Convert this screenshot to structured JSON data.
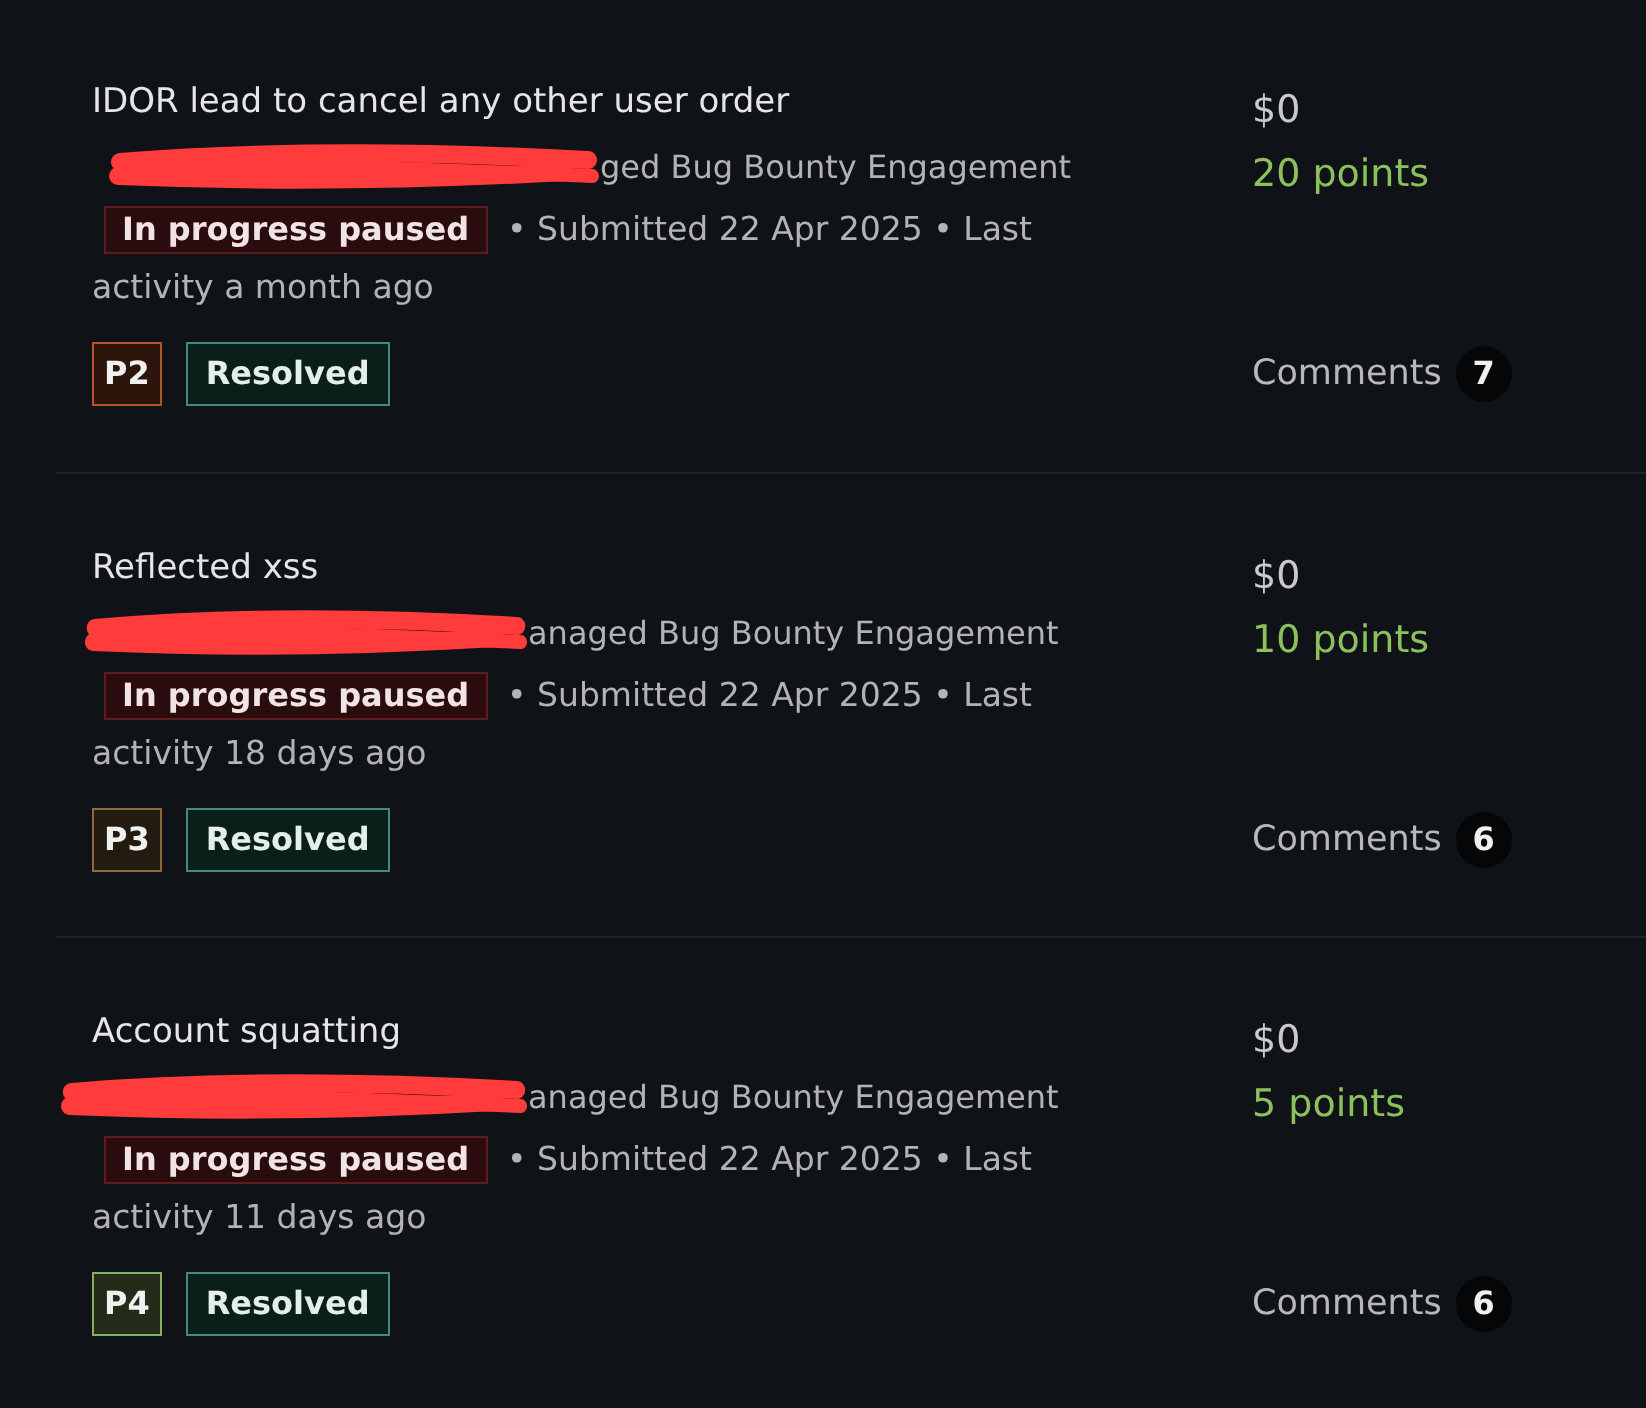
{
  "reports": [
    {
      "title": "IDOR lead to cancel any other user order",
      "program": "ged Bug Bounty Engagement",
      "status": "In progress paused",
      "meta_lines": [
        "• Submitted 22 Apr 2025 • Last",
        "activity a month ago"
      ],
      "severity": {
        "label": "P2",
        "color": "#b5542a"
      },
      "state": "Resolved",
      "bounty": "$0",
      "points": "20 points",
      "comments_label": "Comments",
      "comments_count": "7"
    },
    {
      "title": "Reflected xss",
      "program": "anaged Bug Bounty Engagement",
      "status": "In progress paused",
      "meta_lines": [
        "• Submitted 22 Apr 2025 • Last",
        "activity 18 days ago"
      ],
      "severity": {
        "label": "P3",
        "color": "#8c6a3c"
      },
      "state": "Resolved",
      "bounty": "$0",
      "points": "10 points",
      "comments_label": "Comments",
      "comments_count": "6"
    },
    {
      "title": "Account squatting",
      "program": "anaged Bug Bounty Engagement",
      "status": "In progress paused",
      "meta_lines": [
        "• Submitted 22 Apr 2025 • Last",
        "activity 11 days ago"
      ],
      "severity": {
        "label": "P4",
        "color": "#86b060"
      },
      "state": "Resolved",
      "bounty": "$0",
      "points": "5 points",
      "comments_label": "Comments",
      "comments_count": "6"
    }
  ]
}
